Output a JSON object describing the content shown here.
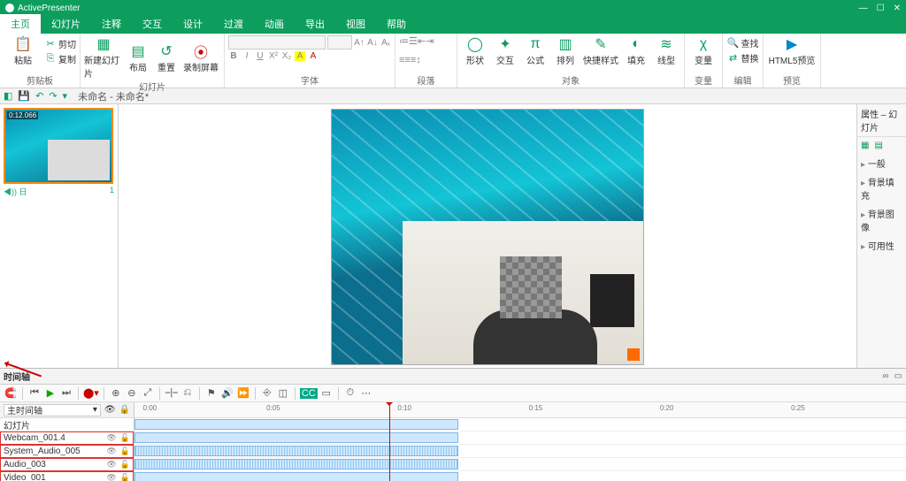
{
  "app": {
    "name": "ActivePresenter"
  },
  "tabs": [
    "主页",
    "幻灯片",
    "注释",
    "交互",
    "设计",
    "过渡",
    "动画",
    "导出",
    "视图",
    "帮助"
  ],
  "active_tab": 0,
  "ribbon": {
    "clipboard": {
      "paste": "粘贴",
      "cut": "剪切",
      "copy": "复制",
      "label": "剪贴板"
    },
    "slides": {
      "new": "新建幻灯片",
      "layout": "布局",
      "reset": "重置",
      "record": "录制屏幕",
      "label": "幻灯片"
    },
    "font": {
      "label": "字体",
      "face": "",
      "size": ""
    },
    "para": {
      "label": "段落"
    },
    "objects": {
      "shape": "形状",
      "interact": "交互",
      "formula": "公式",
      "arrange": "排列",
      "quick": "快捷样式",
      "fill": "填充",
      "line": "线型",
      "label": "对象"
    },
    "var": {
      "var": "变量",
      "label": "变量"
    },
    "edit": {
      "find": "查找",
      "replace": "替换",
      "label": "编辑"
    },
    "preview": {
      "btn": "HTML5预览",
      "label": "预览"
    }
  },
  "qat": {
    "doc": "未命名 - 未命名*"
  },
  "thumb": {
    "time": "0:12.066",
    "sound_index": "◀)) 日",
    "index": "1"
  },
  "props": {
    "title": "属性 – 幻灯片",
    "items": [
      "一般",
      "背景填充",
      "背景图像",
      "可用性"
    ]
  },
  "timeline": {
    "title": "时间轴",
    "dropdown": "主时间轴",
    "ruler": [
      "0:00",
      "0:05",
      "0:10",
      "0:15",
      "0:20",
      "0:25"
    ],
    "slide_row": "幻灯片",
    "tracks": [
      "Webcam_001.4",
      "System_Audio_005",
      "Audio_003",
      "Video_001"
    ]
  }
}
